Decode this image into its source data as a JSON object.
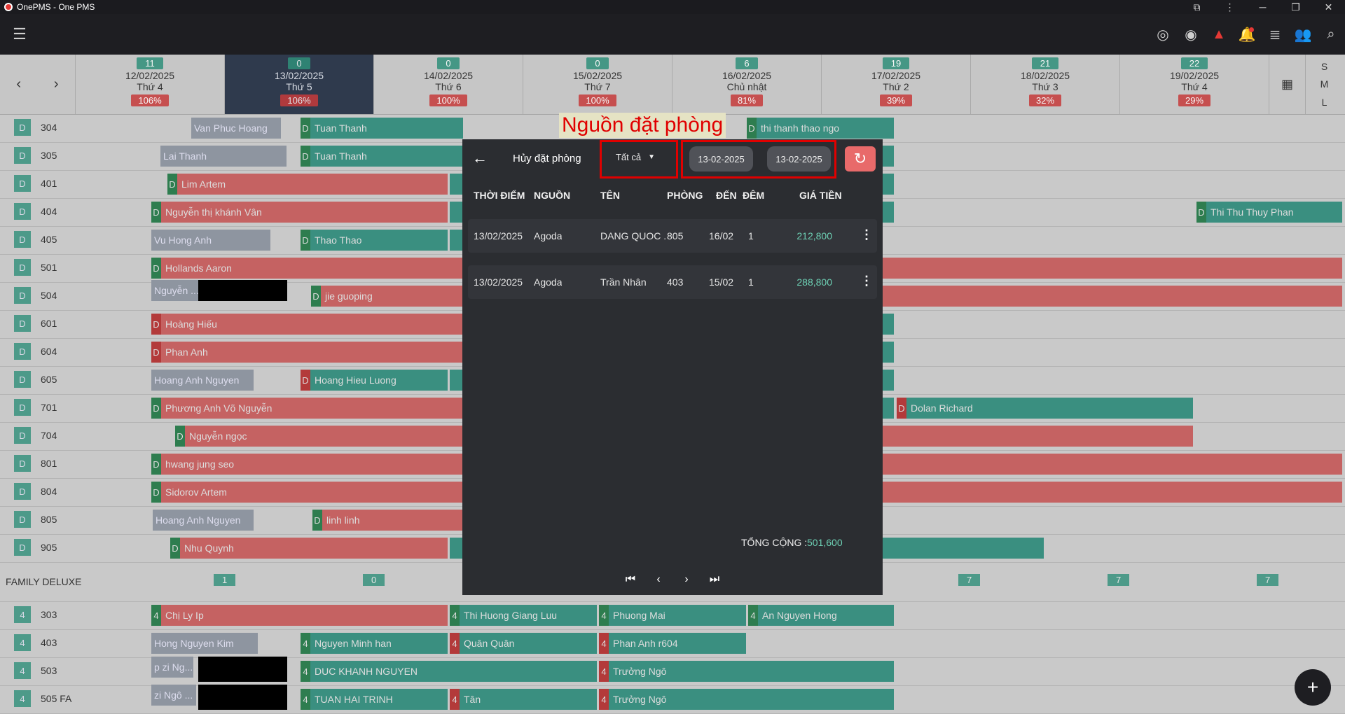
{
  "window": {
    "title": "OnePMS - One PMS"
  },
  "topbar_icons": [
    "fingerprint-icon",
    "eye-icon",
    "warning-icon",
    "bell-icon",
    "list-icon",
    "add-user-icon",
    "search-icon"
  ],
  "days": [
    {
      "count": "11",
      "date": "12/02/2025",
      "weekday": "Thứ 4",
      "occupancy": "106%"
    },
    {
      "count": "0",
      "date": "13/02/2025",
      "weekday": "Thứ 5",
      "occupancy": "106%"
    },
    {
      "count": "0",
      "date": "14/02/2025",
      "weekday": "Thứ 6",
      "occupancy": "100%"
    },
    {
      "count": "0",
      "date": "15/02/2025",
      "weekday": "Thứ 7",
      "occupancy": "100%"
    },
    {
      "count": "6",
      "date": "16/02/2025",
      "weekday": "Chủ nhật",
      "occupancy": "81%"
    },
    {
      "count": "19",
      "date": "17/02/2025",
      "weekday": "Thứ 2",
      "occupancy": "39%"
    },
    {
      "count": "21",
      "date": "18/02/2025",
      "weekday": "Thứ 3",
      "occupancy": "32%"
    },
    {
      "count": "22",
      "date": "19/02/2025",
      "weekday": "Thứ 4",
      "occupancy": "29%"
    }
  ],
  "size_toggle": [
    "S",
    "M",
    "L"
  ],
  "rooms": [
    {
      "type": "D",
      "num": "304"
    },
    {
      "type": "D",
      "num": "305"
    },
    {
      "type": "D",
      "num": "401"
    },
    {
      "type": "D",
      "num": "404"
    },
    {
      "type": "D",
      "num": "405"
    },
    {
      "type": "D",
      "num": "501"
    },
    {
      "type": "D",
      "num": "504"
    },
    {
      "type": "D",
      "num": "601"
    },
    {
      "type": "D",
      "num": "604"
    },
    {
      "type": "D",
      "num": "605"
    },
    {
      "type": "D",
      "num": "701"
    },
    {
      "type": "D",
      "num": "704"
    },
    {
      "type": "D",
      "num": "801"
    },
    {
      "type": "D",
      "num": "804"
    },
    {
      "type": "D",
      "num": "805"
    },
    {
      "type": "D",
      "num": "905"
    }
  ],
  "group": {
    "name": "FAMILY DELUXE",
    "counts": [
      "1",
      "0",
      "7",
      "7",
      "7"
    ]
  },
  "rooms2": [
    {
      "type": "4",
      "num": "303"
    },
    {
      "type": "4",
      "num": "403"
    },
    {
      "type": "4",
      "num": "503"
    },
    {
      "type": "4",
      "num": "505 FA"
    }
  ],
  "bookings": {
    "b1": "Van Phuc Hoang",
    "b2": "Tuan Thanh",
    "b3": "thi thanh thao ngo",
    "b4": "Lai Thanh",
    "b5": "Tuan Thanh",
    "b6": "Lim Artem",
    "b7": "Nguyễn thị khánh Vân",
    "b8": "Thi Thu Thuy Phan",
    "b9": "Vu Hong Anh",
    "b10": "Thao Thao",
    "b11": "Hollands Aaron",
    "b12": "Nguyễn ...",
    "b13": "jie guoping",
    "b14": "Hoàng Hiếu",
    "b15": "Phan Anh",
    "b16": "Hoang Anh Nguyen",
    "b17": "Hoang Hieu Luong",
    "b18": "Phương Anh Võ Nguyễn",
    "b19": "Dolan Richard",
    "b20": "Nguyễn ngọc",
    "b21": "hwang jung seo",
    "b22": "Sidorov Artem",
    "b23": "Hoang Anh Nguyen",
    "b24": "linh linh",
    "b25": "Nhu Quynh",
    "c1": "Chị Ly Ip",
    "c2": "Thi Huong Giang Luu",
    "c3": "Phuong Mai",
    "c4": "An Nguyen Hong",
    "c5": "Hong Nguyen Kim",
    "c6": "Nguyen Minh han",
    "c7": "Quân Quân",
    "c8": "Phan Anh r604",
    "c9": "p  zi Ng... n",
    "c10": "DUC KHANH NGUYEN",
    "c11": "Trưởng Ngô",
    "c12": "zi Ngô ... n",
    "c13": "TUAN HAI TRINH",
    "c14": "Tân",
    "c15": "Trưởng Ngô"
  },
  "tag_letters": {
    "D": "D",
    "four": "4"
  },
  "modal": {
    "title": "Hủy đặt phòng",
    "source_value": "Tất cả",
    "date_from": "13-02-2025",
    "date_to": "13-02-2025",
    "columns": [
      "THỜI ĐIỂM",
      "NGUỒN",
      "TÊN",
      "PHÒNG",
      "ĐẾN",
      "ĐÊM",
      "GIÁ TIỀN"
    ],
    "rows": [
      {
        "time": "13/02/2025",
        "source": "Agoda",
        "name": "DANG QUOC ...",
        "room": "805",
        "arrive": "16/02",
        "nights": "1",
        "price": "212,800"
      },
      {
        "time": "13/02/2025",
        "source": "Agoda",
        "name": "Trần Nhân",
        "room": "403",
        "arrive": "15/02",
        "nights": "1",
        "price": "288,800"
      }
    ],
    "total_label": "TỔNG CỘNG :",
    "total_value": "501,600"
  },
  "annotation": {
    "label": "Nguồn đặt phòng",
    "color": "#e00000"
  },
  "colors": {
    "teal": "#3a8f80",
    "red": "#c56262",
    "accent": "#e86a6a",
    "price": "#6ed1b5"
  }
}
